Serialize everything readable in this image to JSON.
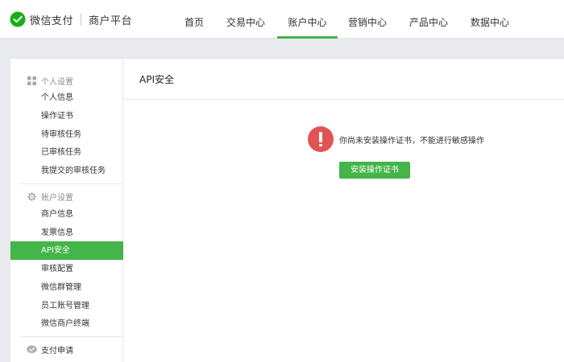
{
  "header": {
    "brand": "微信支付",
    "sub_brand": "商户平台",
    "nav": [
      {
        "label": "首页",
        "active": false
      },
      {
        "label": "交易中心",
        "active": false
      },
      {
        "label": "账户中心",
        "active": true
      },
      {
        "label": "营销中心",
        "active": false
      },
      {
        "label": "产品中心",
        "active": false
      },
      {
        "label": "数据中心",
        "active": false
      }
    ]
  },
  "sidebar": {
    "sections": [
      {
        "title": "个人设置",
        "icon": "grid-icon",
        "items": [
          "个人信息",
          "操作证书",
          "待审核任务",
          "已审核任务",
          "我提交的审核任务"
        ]
      },
      {
        "title": "账户设置",
        "icon": "gear-icon",
        "items": [
          "商户信息",
          "发票信息",
          "API安全",
          "审核配置",
          "微信群管理",
          "员工账号管理",
          "微信商户终端"
        ]
      },
      {
        "title": "支付申请",
        "icon": "wechat-pay-icon",
        "items": []
      }
    ],
    "active_item": "API安全"
  },
  "main": {
    "title": "API安全",
    "alert_text": "你尚未安装操作证书，不能进行敏感操作",
    "install_button": "安装操作证书"
  },
  "colors": {
    "accent": "#44b549",
    "alert": "#e25353"
  }
}
